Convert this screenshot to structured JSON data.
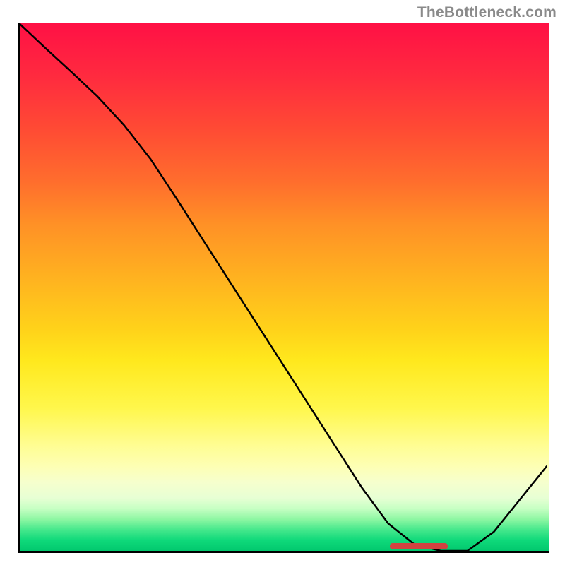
{
  "attribution": "TheBottleneck.com",
  "chart_data": {
    "type": "line",
    "title": "",
    "xlabel": "",
    "ylabel": "",
    "xlim": [
      0,
      100
    ],
    "ylim": [
      0,
      100
    ],
    "grid": false,
    "legend": false,
    "series": [
      {
        "name": "bottleneck-curve",
        "x": [
          0,
          5,
          10,
          15,
          20,
          25,
          30,
          35,
          40,
          45,
          50,
          55,
          60,
          65,
          70,
          75,
          80,
          85,
          90,
          95,
          100
        ],
        "y": [
          100,
          95.3,
          90.7,
          86,
          80.6,
          74.2,
          66.6,
          58.8,
          51,
          43.2,
          35.4,
          27.6,
          19.8,
          12,
          5.2,
          1.2,
          0,
          0,
          3.6,
          9.8,
          16
        ],
        "color": "#000000",
        "stroke_width": 2
      }
    ],
    "annotations": [
      {
        "name": "optimum-band",
        "type": "marker",
        "x_range": [
          76,
          88
        ],
        "y": 0.5,
        "color": "#d24240"
      }
    ],
    "background": {
      "type": "vertical-gradient",
      "stops": [
        {
          "pos": 0.0,
          "color": "#ff1045"
        },
        {
          "pos": 0.5,
          "color": "#ffb120"
        },
        {
          "pos": 0.75,
          "color": "#fffd92"
        },
        {
          "pos": 1.0,
          "color": "#02c86e"
        }
      ]
    }
  }
}
